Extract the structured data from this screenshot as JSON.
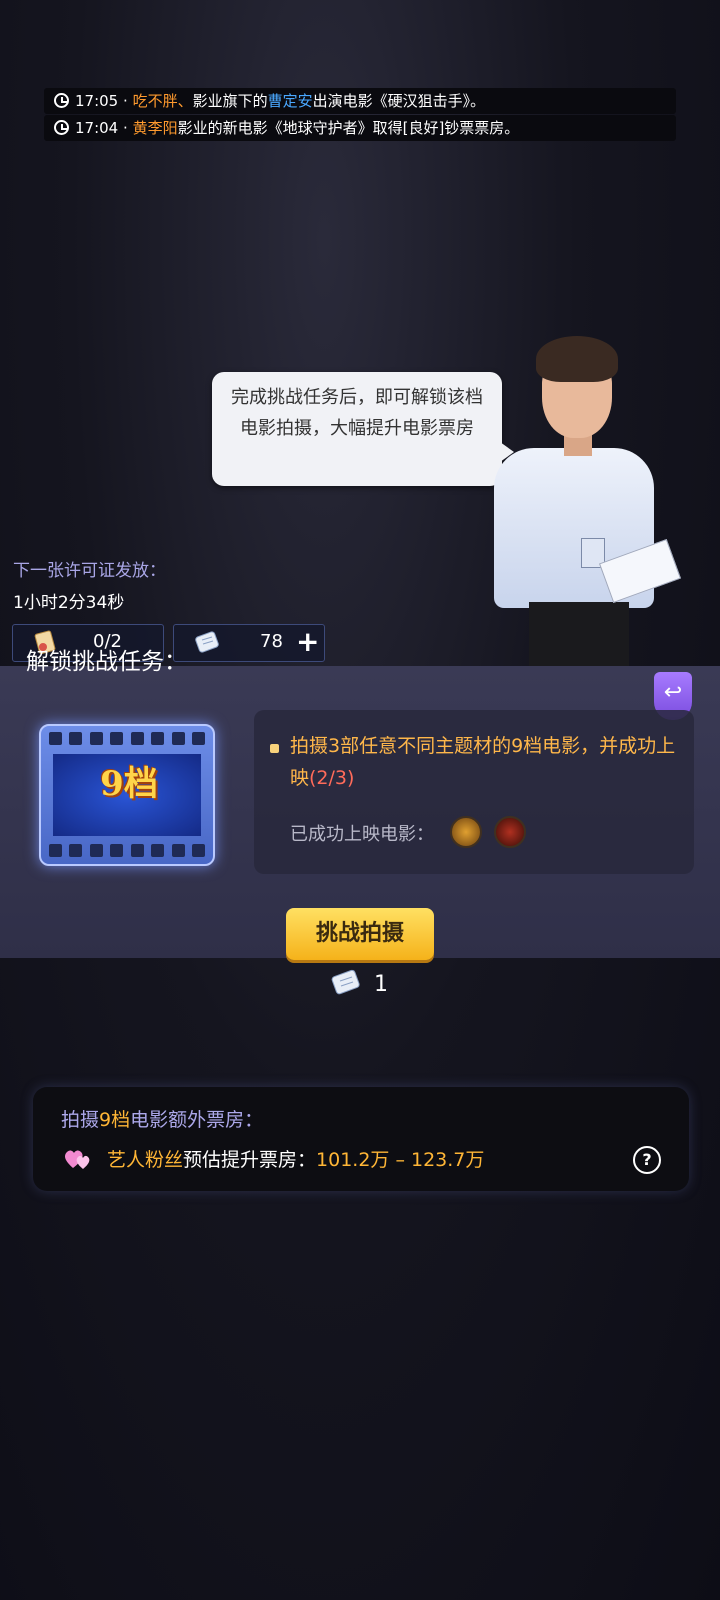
{
  "news": [
    {
      "time": "17:05",
      "sep": "·",
      "name": "吃不胖",
      "punct": "、",
      "mid": "影业旗下的",
      "actor": "曹定安",
      "rest": "出演电影《硬汉狙击手》。"
    },
    {
      "time": "17:04",
      "sep": "·",
      "name": "黄李阳",
      "mid": "影业的新电影《地球守护者》取得[良好]钞票票房。"
    }
  ],
  "bubble": {
    "text": "完成挑战任务后，即可解锁该档电影拍摄，大幅提升电影票房"
  },
  "license": {
    "label": "下一张许可证发放：",
    "time": "1小时2分34秒"
  },
  "resources": [
    {
      "icon": "license-icon",
      "value": "0/2"
    },
    {
      "icon": "script-icon",
      "value": "78",
      "add_label": "+"
    }
  ],
  "unlock": {
    "title": "解锁挑战任务：",
    "return_icon": "↩",
    "film_level": "9档",
    "task_text": "拍摄3部任意不同主题材的9档电影，并成功上映",
    "task_progress": "(2/3)",
    "done_label": "已成功上映电影：",
    "challenge_button": "挑战拍摄",
    "cost": "1"
  },
  "bonus": {
    "title_prefix": "拍摄",
    "title_hl": "9档",
    "title_suffix": "电影额外票房：",
    "source": "艺人粉丝",
    "estimate_label": "预估提升票房：",
    "range": "101.2万 – 123.7万",
    "help": "?"
  },
  "colors": {
    "accent_orange": "#ffb636",
    "accent_purple": "#aca8ea",
    "button_yellow": "#f5b21a"
  }
}
